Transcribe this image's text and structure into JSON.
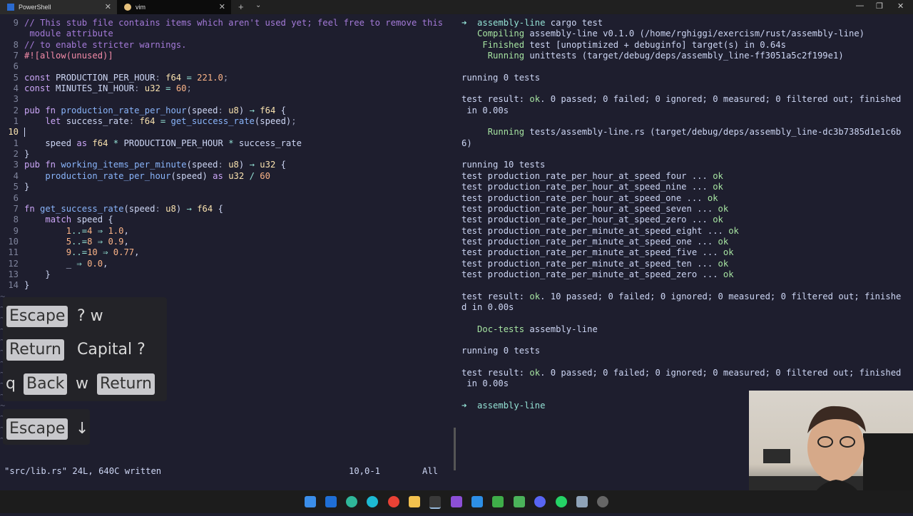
{
  "tabs": [
    {
      "label": "PowerShell"
    },
    {
      "label": "vim"
    }
  ],
  "editor": {
    "status_left": "\"src/lib.rs\" 24L, 640C written",
    "status_pos": "10,0-1",
    "status_scroll": "All"
  },
  "keys": {
    "k1": "Escape",
    "t1": "? w",
    "k2": "Return",
    "t2": "Capital ?",
    "t3": "q",
    "k3": "Back",
    "t4": "w",
    "k4": "Return",
    "k5": "Escape",
    "t5": "↓"
  },
  "terminal": {
    "prompt1": "assembly-line",
    "cmd1": "cargo test",
    "compiling": "Compiling",
    "compiling_rest": "assembly-line v0.1.0 (/home/rghiggi/exercism/rust/assembly-line)",
    "finished": "Finished",
    "finished_rest": "test [unoptimized + debuginfo] target(s) in 0.64s",
    "running1": "Running",
    "running1_rest": "unittests (target/debug/deps/assembly_line-ff3051a5c2f199e1)",
    "r0": "running 0 tests",
    "res1a": "test result: ",
    "res_ok": "ok",
    "res1b": ". 0 passed; 0 failed; 0 ignored; 0 measured; 0 filtered out; finished",
    "res1c": " in 0.00s",
    "running2": "Running",
    "running2_rest": "tests/assembly-line.rs (target/debug/deps/assembly_line-dc3b7385d1e1c6b",
    "running2_cont": "6)",
    "r10": "running 10 tests",
    "tests": [
      {
        "name": "test production_rate_per_hour_at_speed_four ... ",
        "st": "ok"
      },
      {
        "name": "test production_rate_per_hour_at_speed_nine ... ",
        "st": "ok"
      },
      {
        "name": "test production_rate_per_hour_at_speed_one ... ",
        "st": "ok"
      },
      {
        "name": "test production_rate_per_hour_at_speed_seven ... ",
        "st": "ok"
      },
      {
        "name": "test production_rate_per_hour_at_speed_zero ... ",
        "st": "ok"
      },
      {
        "name": "test production_rate_per_minute_at_speed_eight ... ",
        "st": "ok"
      },
      {
        "name": "test production_rate_per_minute_at_speed_one ... ",
        "st": "ok"
      },
      {
        "name": "test production_rate_per_minute_at_speed_five ... ",
        "st": "ok"
      },
      {
        "name": "test production_rate_per_minute_at_speed_ten ... ",
        "st": "ok"
      },
      {
        "name": "test production_rate_per_minute_at_speed_zero ... ",
        "st": "ok"
      }
    ],
    "res2b": ". 10 passed; 0 failed; 0 ignored; 0 measured; 0 filtered out; finishe",
    "res2c": "d in 0.00s",
    "doctests": "Doc-tests",
    "doctests_rest": "assembly-line",
    "r0b": "running 0 tests",
    "prompt2": "assembly-line"
  }
}
